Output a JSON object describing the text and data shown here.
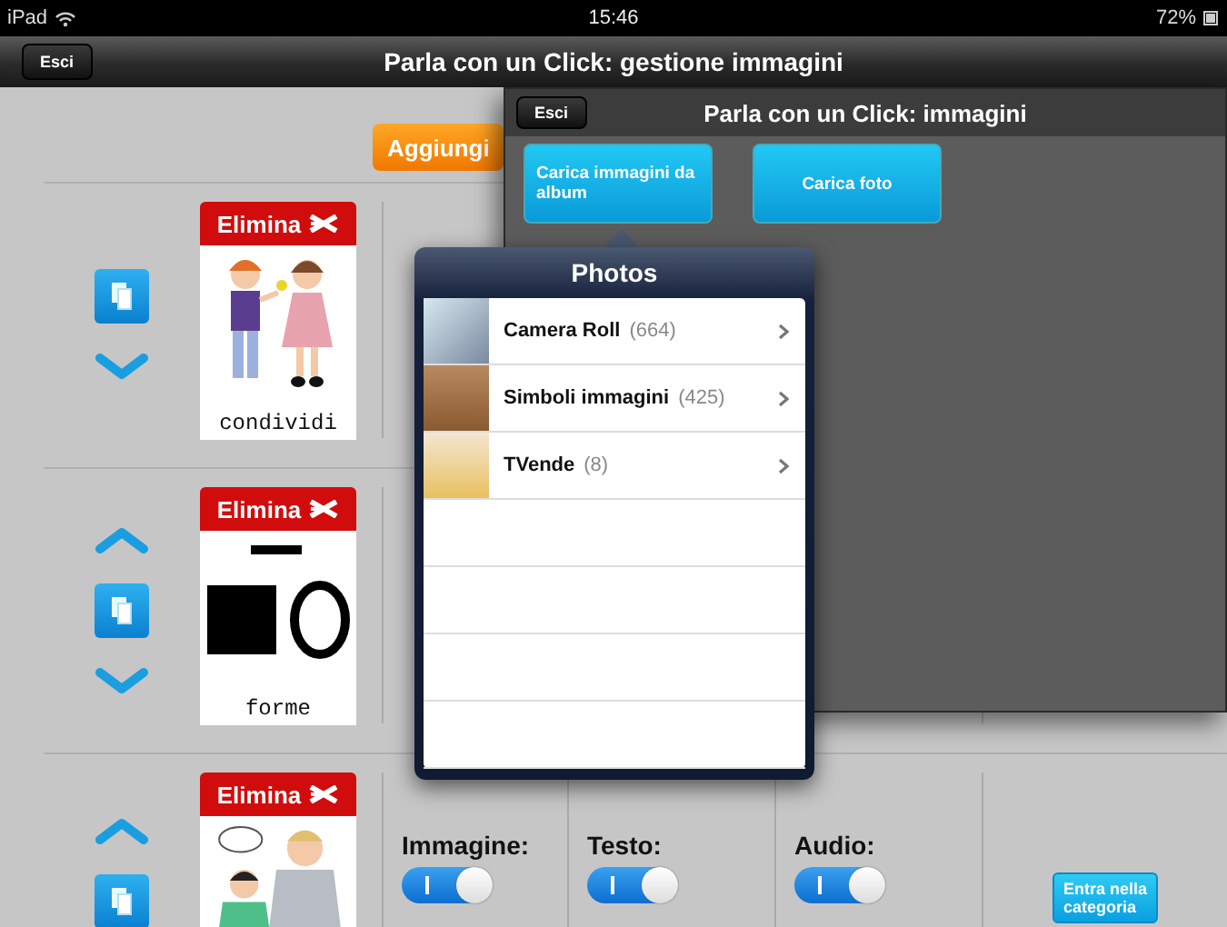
{
  "status_bar": {
    "device": "iPad",
    "time": "15:46",
    "battery": "72%"
  },
  "nav_bar": {
    "back_button": "Esci",
    "title": "Parla con un Click: gestione immagini"
  },
  "add_button": "Aggiungi",
  "items": [
    {
      "kind": "children",
      "delete_label": "Elimina",
      "caption": "condividi"
    },
    {
      "kind": "shapes",
      "delete_label": "Elimina",
      "caption": "forme"
    },
    {
      "kind": "people",
      "delete_label": "Elimina",
      "settings": [
        {
          "label": "Immagine:",
          "on": true
        },
        {
          "label": "Testo:",
          "on": true
        },
        {
          "label": "Audio:",
          "on": true
        }
      ],
      "enter_button": "Entra nella categoria"
    }
  ],
  "modal": {
    "close_button": "Esci",
    "title": "Parla con un Click: immagini",
    "buttons": [
      {
        "label": "Carica immagini da album"
      },
      {
        "label": "Carica foto"
      }
    ]
  },
  "popover": {
    "title": "Photos",
    "albums": [
      {
        "name": "Camera Roll",
        "count": "(664)"
      },
      {
        "name": "Simboli immagini",
        "count": "(425)"
      },
      {
        "name": "TVende",
        "count": "(8)"
      }
    ]
  }
}
